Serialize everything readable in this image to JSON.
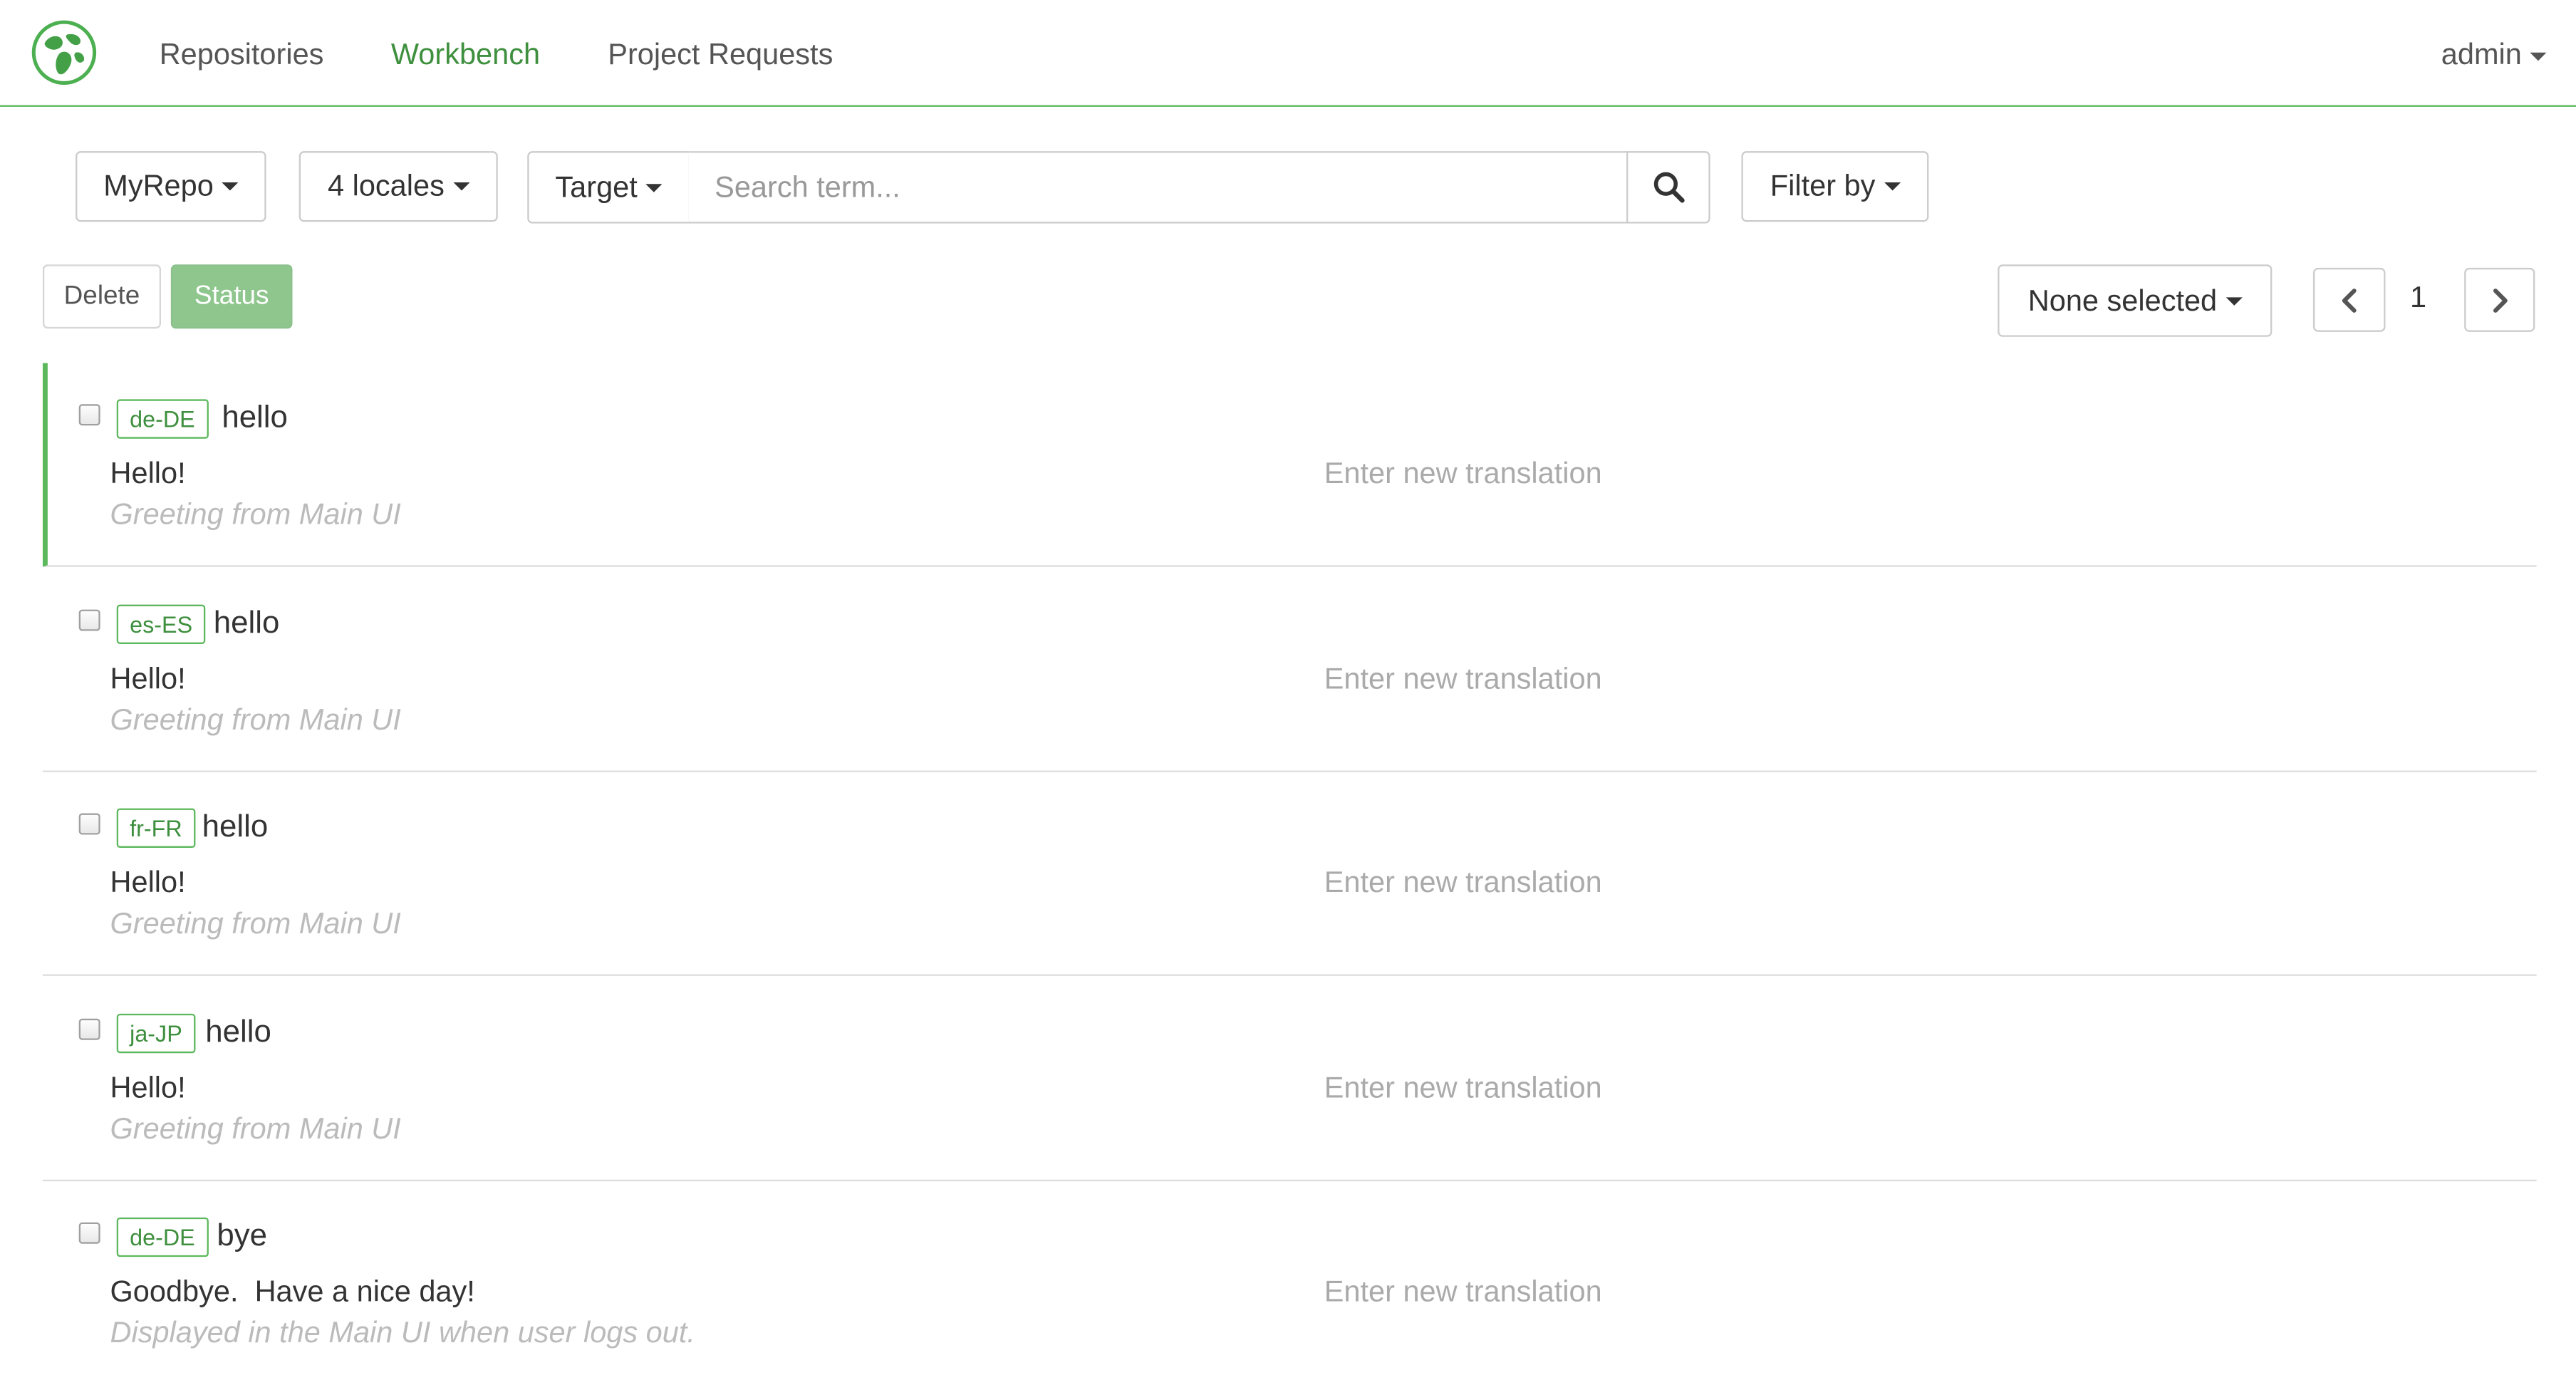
{
  "navbar": {
    "logo": "globe-leaf-logo",
    "links": [
      {
        "label": "Repositories",
        "active": false
      },
      {
        "label": "Workbench",
        "active": true
      },
      {
        "label": "Project Requests",
        "active": false
      }
    ],
    "user": "admin"
  },
  "toolbar": {
    "repo_label": "MyRepo",
    "locales_label": "4 locales",
    "target_label": "Target",
    "search_placeholder": "Search term...",
    "search_value": "",
    "filter_label": "Filter by"
  },
  "actions": {
    "delete_label": "Delete",
    "status_label": "Status",
    "selection_label": "None selected"
  },
  "pagination": {
    "current_page": "1"
  },
  "rows": [
    {
      "locale": "de-DE",
      "key": "hello",
      "source": "Hello!",
      "comment": "Greeting from Main UI",
      "target_placeholder": "Enter new translation",
      "selected": true
    },
    {
      "locale": "es-ES",
      "key": "hello",
      "source": "Hello!",
      "comment": "Greeting from Main UI",
      "target_placeholder": "Enter new translation",
      "selected": false
    },
    {
      "locale": "fr-FR",
      "key": "hello",
      "source": "Hello!",
      "comment": "Greeting from Main UI",
      "target_placeholder": "Enter new translation",
      "selected": false
    },
    {
      "locale": "ja-JP",
      "key": "hello",
      "source": "Hello!",
      "comment": "Greeting from Main UI",
      "target_placeholder": "Enter new translation",
      "selected": false
    },
    {
      "locale": "de-DE",
      "key": "bye",
      "source": "Goodbye.  Have a nice day!",
      "comment": "Displayed in the Main UI when user logs out.",
      "target_placeholder": "Enter new translation",
      "selected": false
    }
  ],
  "colors": {
    "brand_green": "#5cb85c",
    "active_link": "#3e8f3e",
    "status_button": "#8ec68e"
  }
}
